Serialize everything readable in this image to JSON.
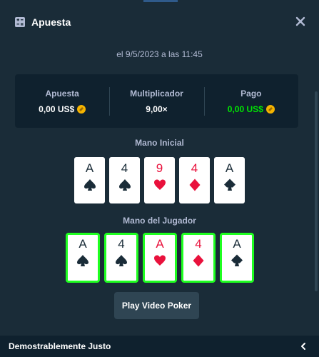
{
  "modal": {
    "title": "Apuesta",
    "title_icon": "bet-slip-icon",
    "close_icon": "close-icon"
  },
  "date": "el 9/5/2023 a las 11:45",
  "stats": [
    {
      "label": "Apuesta",
      "value": "0,00 US$",
      "coin": true,
      "color": "#ffffff"
    },
    {
      "label": "Multiplicador",
      "value": "9,00×",
      "coin": false,
      "color": "#ffffff"
    },
    {
      "label": "Pago",
      "value": "0,00 US$",
      "coin": true,
      "color": "#00e701"
    }
  ],
  "initial_hand": {
    "label": "Mano Inicial",
    "cards": [
      {
        "rank": "A",
        "suit": "spade"
      },
      {
        "rank": "4",
        "suit": "spade"
      },
      {
        "rank": "9",
        "suit": "heart"
      },
      {
        "rank": "4",
        "suit": "diamond"
      },
      {
        "rank": "A",
        "suit": "club"
      }
    ]
  },
  "player_hand": {
    "label": "Mano del Jugador",
    "cards": [
      {
        "rank": "A",
        "suit": "spade",
        "held": true
      },
      {
        "rank": "4",
        "suit": "spade",
        "held": true
      },
      {
        "rank": "A",
        "suit": "heart",
        "held": true
      },
      {
        "rank": "4",
        "suit": "diamond",
        "held": true
      },
      {
        "rank": "A",
        "suit": "club",
        "held": true
      }
    ]
  },
  "play_button": "Play Video Poker",
  "footer": {
    "label": "Demostrablemente Justo",
    "chevron_icon": "chevron-left-icon"
  },
  "colors": {
    "background": "#1a2c38",
    "panel": "#0f212e",
    "muted_text": "#b1bad3",
    "win_green": "#00e701",
    "held_border": "#1fff20",
    "red_suit": "#e9113c",
    "black_suit": "#1a2c38"
  }
}
